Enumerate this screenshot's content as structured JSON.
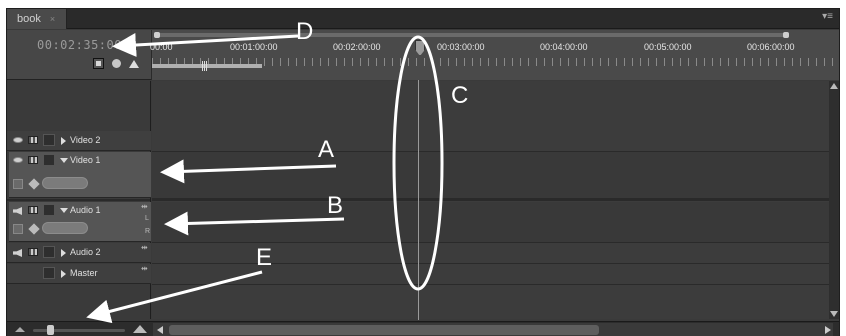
{
  "window": {
    "tab_label": "book",
    "tab_close": "×",
    "panel_menu": "▾≡"
  },
  "header": {
    "timecode": "00:02:35:00",
    "icons": [
      "snap-icon",
      "marker-icon",
      "set-unnumbered-marker-icon"
    ],
    "ruler_labels": [
      "00:00",
      "00:01:00:00",
      "00:02:00:00",
      "00:03:00:00",
      "00:04:00:00",
      "00:05:00:00",
      "00:06:00:00"
    ]
  },
  "tracks": [
    {
      "name": "Video 2",
      "kind": "video",
      "expanded": false
    },
    {
      "name": "Video 1",
      "kind": "video",
      "expanded": true
    },
    {
      "name": "Audio 1",
      "kind": "audio",
      "expanded": true,
      "channel_labels": [
        "L",
        "R"
      ]
    },
    {
      "name": "Audio 2",
      "kind": "audio",
      "expanded": false
    },
    {
      "name": "Master",
      "kind": "master",
      "expanded": false
    }
  ],
  "annotations": {
    "labels": [
      "A",
      "B",
      "C",
      "D",
      "E"
    ],
    "color": "#ffffff"
  },
  "colors": {
    "panel_bg": "#3a3a3a",
    "header_bg": "#474747",
    "expanded_track_bg": "#555555",
    "ruler_text": "#e6e6e6",
    "timecode_text": "#9a9a9a"
  }
}
